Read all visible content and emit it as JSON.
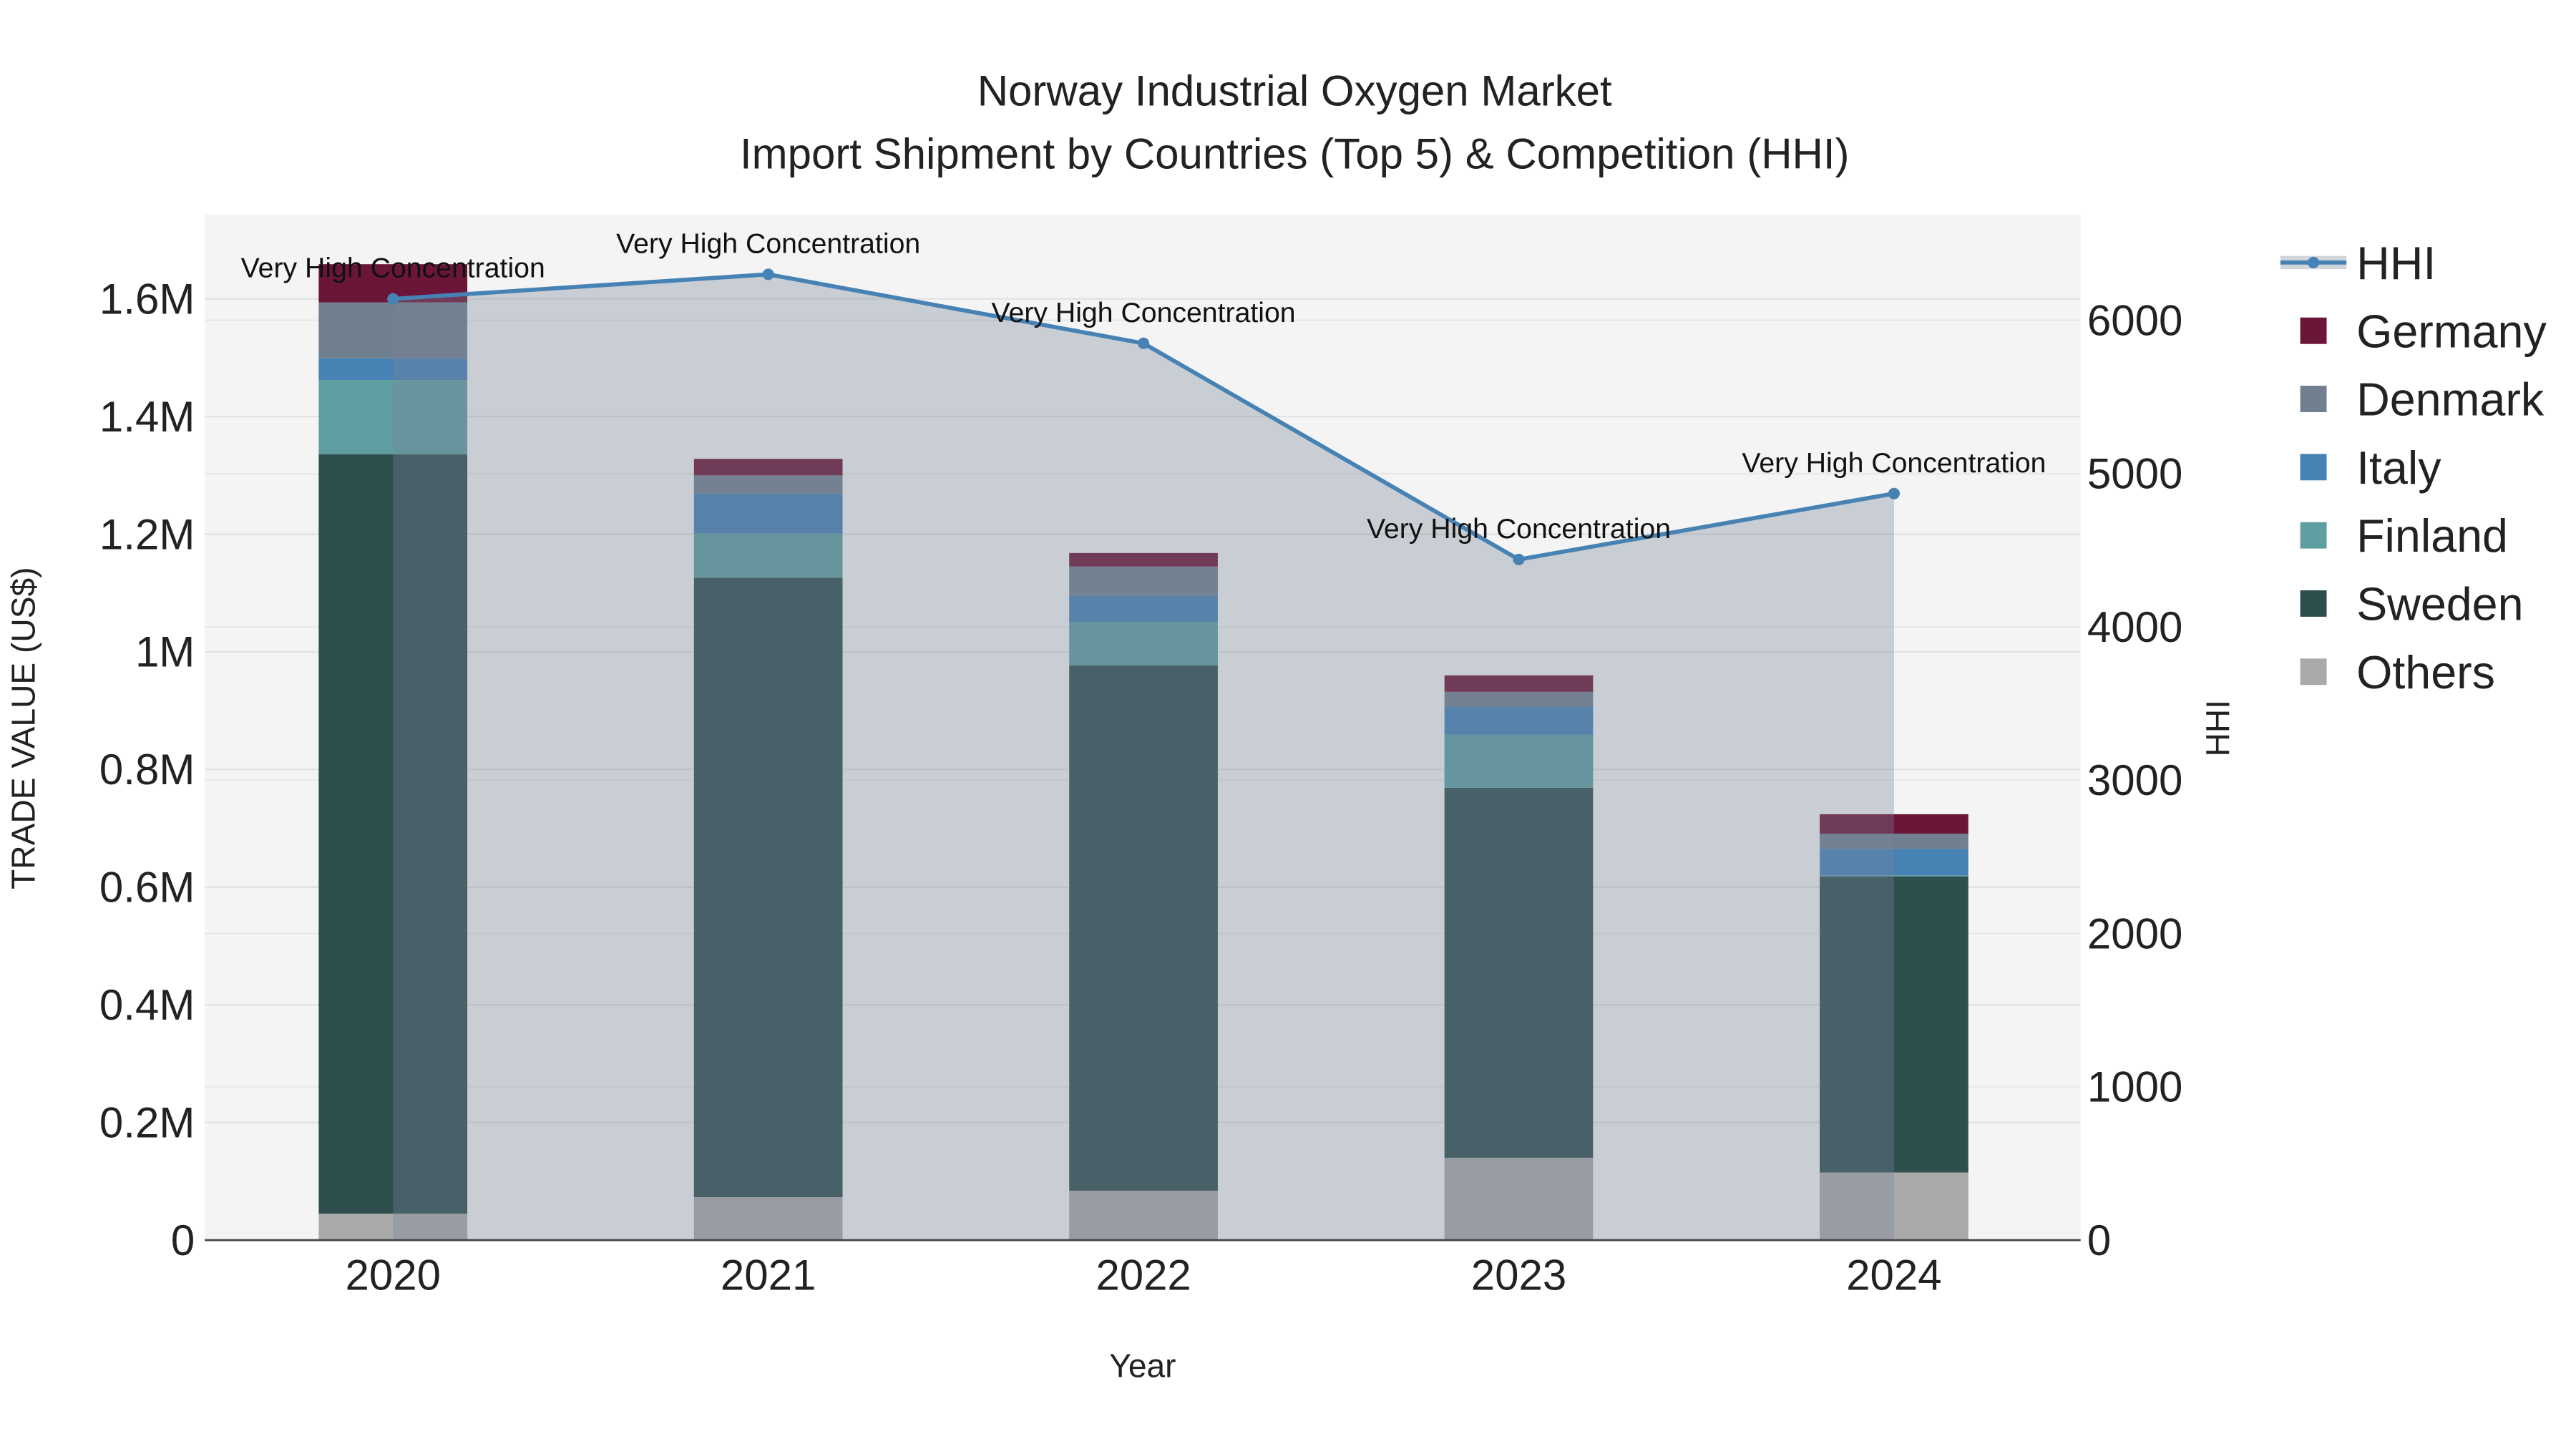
{
  "chart_data": {
    "type": "bar",
    "title": "Norway Industrial Oxygen Market",
    "subtitle": "Import Shipment by Countries (Top 5) & Competition (HHI)",
    "xlabel": "Year",
    "ylabel": "TRADE VALUE (US$)",
    "y2label": "HHI",
    "categories": [
      "2020",
      "2021",
      "2022",
      "2023",
      "2024"
    ],
    "ylim": [
      0,
      1740000
    ],
    "y2lim": [
      0,
      6650
    ],
    "yticks": [
      {
        "v": 0,
        "label": "0"
      },
      {
        "v": 200000,
        "label": "0.2M"
      },
      {
        "v": 400000,
        "label": "0.4M"
      },
      {
        "v": 600000,
        "label": "0.6M"
      },
      {
        "v": 800000,
        "label": "0.8M"
      },
      {
        "v": 1000000,
        "label": "1M"
      },
      {
        "v": 1200000,
        "label": "1.2M"
      },
      {
        "v": 1400000,
        "label": "1.4M"
      },
      {
        "v": 1600000,
        "label": "1.6M"
      }
    ],
    "y2ticks": [
      {
        "v": 0,
        "label": "0"
      },
      {
        "v": 1000,
        "label": "1000"
      },
      {
        "v": 2000,
        "label": "2000"
      },
      {
        "v": 3000,
        "label": "3000"
      },
      {
        "v": 4000,
        "label": "4000"
      },
      {
        "v": 5000,
        "label": "5000"
      },
      {
        "v": 6000,
        "label": "6000"
      }
    ],
    "series": [
      {
        "name": "Others",
        "color": "#a9a9a9",
        "values": [
          45000,
          73000,
          84000,
          140000,
          115000
        ]
      },
      {
        "name": "Sweden",
        "color": "#2f4f4f",
        "values": [
          1291000,
          1053000,
          893000,
          629000,
          503000
        ]
      },
      {
        "name": "Finland",
        "color": "#5f9ea0",
        "values": [
          126000,
          75000,
          73000,
          90000,
          2000
        ]
      },
      {
        "name": "Italy",
        "color": "#4682b4",
        "values": [
          37000,
          68000,
          45000,
          48000,
          45000
        ]
      },
      {
        "name": "Denmark",
        "color": "#708090",
        "values": [
          95000,
          31000,
          50000,
          25000,
          26000
        ]
      },
      {
        "name": "Germany",
        "color": "#6b1538",
        "values": [
          65000,
          28000,
          23000,
          28000,
          33000
        ]
      }
    ],
    "hhi": {
      "name": "HHI",
      "color": "#4682b4",
      "values": [
        6140,
        6300,
        5850,
        4440,
        4870
      ],
      "annotations": [
        "Very High Concentration",
        "Very High Concentration",
        "Very High Concentration",
        "Very High Concentration",
        "Very High Concentration"
      ]
    },
    "legend": {
      "placement": "right",
      "order": [
        "HHI",
        "Germany",
        "Denmark",
        "Italy",
        "Finland",
        "Sweden",
        "Others"
      ]
    },
    "grid": true
  }
}
